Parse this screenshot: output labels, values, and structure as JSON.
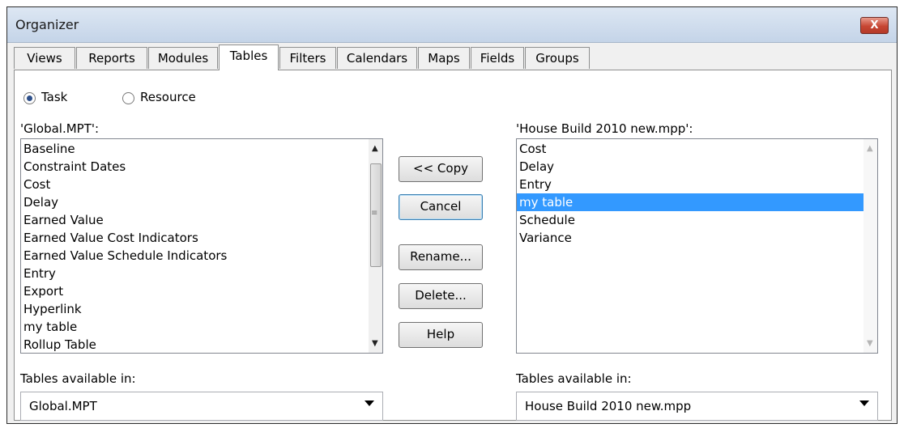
{
  "window": {
    "title": "Organizer",
    "close_label": "X"
  },
  "tabs": [
    "Views",
    "Reports",
    "Modules",
    "Tables",
    "Filters",
    "Calendars",
    "Maps",
    "Fields",
    "Groups"
  ],
  "active_tab": "Tables",
  "radios": [
    {
      "label": "Task",
      "checked": true
    },
    {
      "label": "Resource",
      "checked": false
    }
  ],
  "left_panel": {
    "caption": "'Global.MPT':",
    "items": [
      "Baseline",
      "Constraint Dates",
      "Cost",
      "Delay",
      "Earned Value",
      "Earned Value Cost Indicators",
      "Earned Value Schedule Indicators",
      "Entry",
      "Export",
      "Hyperlink",
      "my table",
      "Rollup Table"
    ],
    "available_label": "Tables available in:",
    "available_value": "Global.MPT"
  },
  "right_panel": {
    "caption": "'House Build 2010 new.mpp':",
    "items": [
      "Cost",
      "Delay",
      "Entry",
      "my table",
      "Schedule",
      "Variance"
    ],
    "selected": "my table",
    "available_label": "Tables available in:",
    "available_value": "House Build 2010 new.mpp"
  },
  "buttons": {
    "copy": "<< Copy",
    "cancel": "Cancel",
    "rename": "Rename...",
    "delete": "Delete...",
    "help": "Help"
  }
}
